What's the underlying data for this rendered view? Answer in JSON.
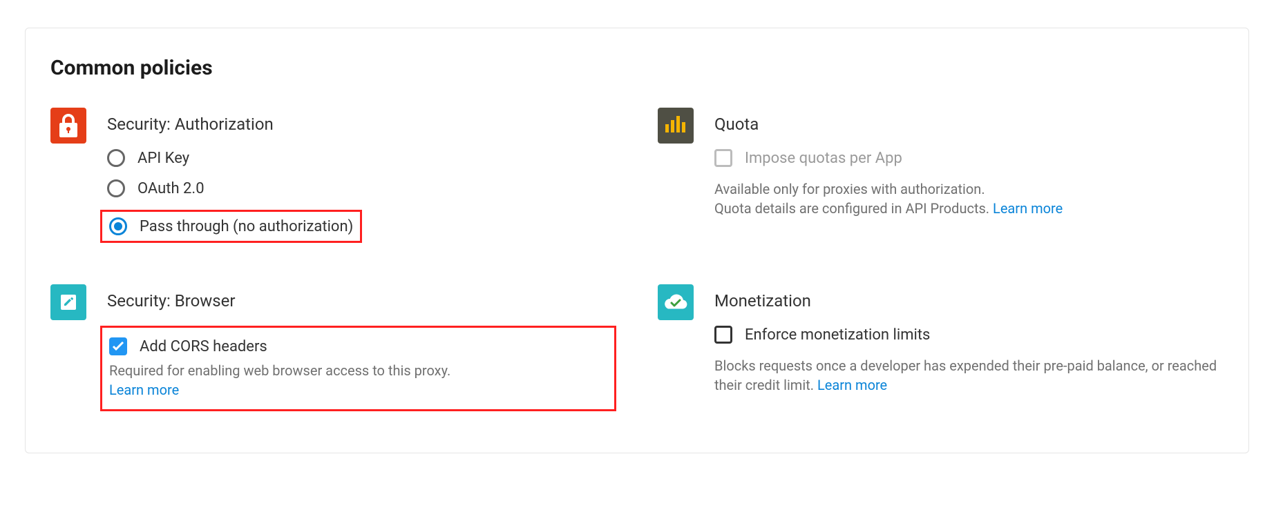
{
  "title": "Common policies",
  "security_auth": {
    "title": "Security: Authorization",
    "options": {
      "api_key": "API Key",
      "oauth": "OAuth 2.0",
      "pass_through": "Pass through (no authorization)"
    }
  },
  "quota": {
    "title": "Quota",
    "option_label": "Impose quotas per App",
    "desc_line1": "Available only for proxies with authorization.",
    "desc_line2": "Quota details are configured in API Products. ",
    "learn_more": "Learn more"
  },
  "security_browser": {
    "title": "Security: Browser",
    "option_label": "Add CORS headers",
    "desc": "Required for enabling web browser access to this proxy.",
    "learn_more": "Learn more"
  },
  "monetization": {
    "title": "Monetization",
    "option_label": "Enforce monetization limits",
    "desc": "Blocks requests once a developer has expended their pre-paid balance, or reached their credit limit. ",
    "learn_more": "Learn more"
  }
}
